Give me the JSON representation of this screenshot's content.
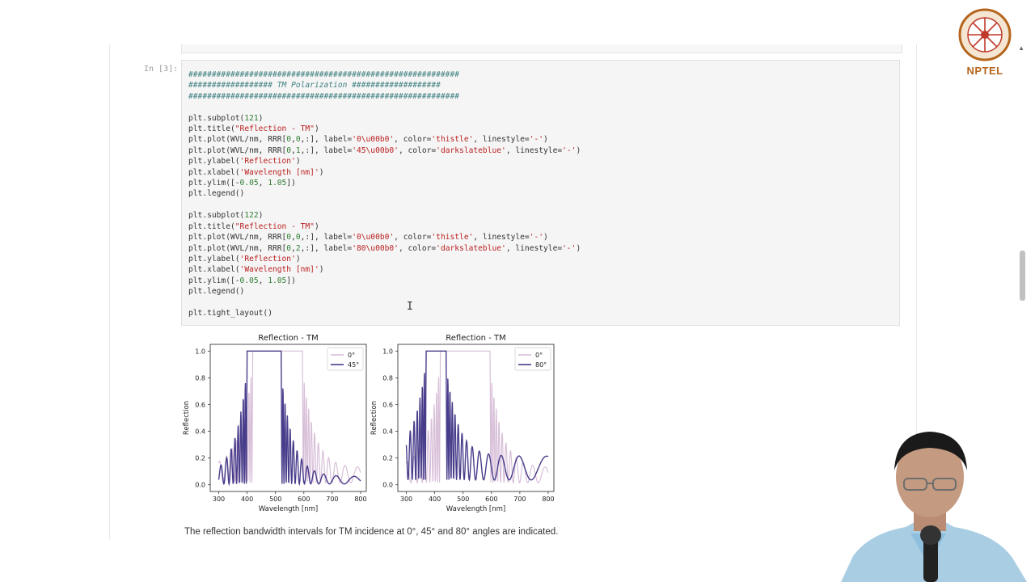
{
  "prompt": "In [3]:",
  "code_lines": [
    {
      "t": "com",
      "s": "##########################################################"
    },
    {
      "t": "com",
      "s": "################## TM Polarization ###################"
    },
    {
      "t": "com",
      "s": "##########################################################"
    },
    {
      "t": "txt",
      "s": ""
    },
    {
      "t": "txt",
      "s": "plt.subplot(121)"
    },
    {
      "t": "txt",
      "s": "plt.title(\"Reflection - TM\")"
    },
    {
      "t": "txt",
      "s": "plt.plot(WVL/nm, RRR[0,0,:], label='0\\u00b0', color='thistle', linestyle='-')"
    },
    {
      "t": "txt",
      "s": "plt.plot(WVL/nm, RRR[0,1,:], label='45\\u00b0', color='darkslateblue', linestyle='-')"
    },
    {
      "t": "txt",
      "s": "plt.ylabel('Reflection')"
    },
    {
      "t": "txt",
      "s": "plt.xlabel('Wavelength [nm]')"
    },
    {
      "t": "txt",
      "s": "plt.ylim([-0.05, 1.05])"
    },
    {
      "t": "txt",
      "s": "plt.legend()"
    },
    {
      "t": "txt",
      "s": ""
    },
    {
      "t": "txt",
      "s": "plt.subplot(122)"
    },
    {
      "t": "txt",
      "s": "plt.title(\"Reflection - TM\")"
    },
    {
      "t": "txt",
      "s": "plt.plot(WVL/nm, RRR[0,0,:], label='0\\u00b0', color='thistle', linestyle='-')"
    },
    {
      "t": "txt",
      "s": "plt.plot(WVL/nm, RRR[0,2,:], label='80\\u00b0', color='darkslateblue', linestyle='-')"
    },
    {
      "t": "txt",
      "s": "plt.ylabel('Reflection')"
    },
    {
      "t": "txt",
      "s": "plt.xlabel('Wavelength [nm]')"
    },
    {
      "t": "txt",
      "s": "plt.ylim([-0.05, 1.05])"
    },
    {
      "t": "txt",
      "s": "plt.legend()"
    },
    {
      "t": "txt",
      "s": ""
    },
    {
      "t": "txt",
      "s": "plt.tight_layout()"
    }
  ],
  "caption": "The reflection bandwidth intervals for TM incidence at 0°, 45° and 80° angles are indicated.",
  "logo": {
    "text": "NPTEL",
    "color": "#b5651d"
  },
  "colors": {
    "thistle": "#d8bfd8",
    "darkslateblue": "#483d8b",
    "code_bg": "#f5f5f5"
  },
  "chart_data": [
    {
      "type": "line",
      "title": "Reflection - TM",
      "xlabel": "Wavelength [nm]",
      "ylabel": "Reflection",
      "xlim": [
        270,
        820
      ],
      "ylim": [
        -0.05,
        1.05
      ],
      "xticks": [
        300,
        400,
        500,
        600,
        700,
        800
      ],
      "yticks": [
        0.0,
        0.2,
        0.4,
        0.6,
        0.8,
        1.0
      ],
      "legend": "top-right",
      "series": [
        {
          "name": "0°",
          "color": "#d8bfd8",
          "band": [
            420,
            595
          ],
          "floor": 0.05,
          "peak": 0.25
        },
        {
          "name": "45°",
          "color": "#483d8b",
          "band": [
            400,
            520
          ],
          "floor": 0.02,
          "peak": 0.14
        }
      ]
    },
    {
      "type": "line",
      "title": "Reflection - TM",
      "xlabel": "Wavelength [nm]",
      "ylabel": "Reflection",
      "xlim": [
        270,
        820
      ],
      "ylim": [
        -0.05,
        1.05
      ],
      "xticks": [
        300,
        400,
        500,
        600,
        700,
        800
      ],
      "yticks": [
        0.0,
        0.2,
        0.4,
        0.6,
        0.8,
        1.0
      ],
      "legend": "top-right",
      "series": [
        {
          "name": "0°",
          "color": "#d8bfd8",
          "band": [
            420,
            595
          ],
          "floor": 0.05,
          "peak": 0.25
        },
        {
          "name": "80°",
          "color": "#483d8b",
          "band": [
            370,
            440
          ],
          "floor": 0.12,
          "peak": 0.26
        }
      ]
    }
  ]
}
